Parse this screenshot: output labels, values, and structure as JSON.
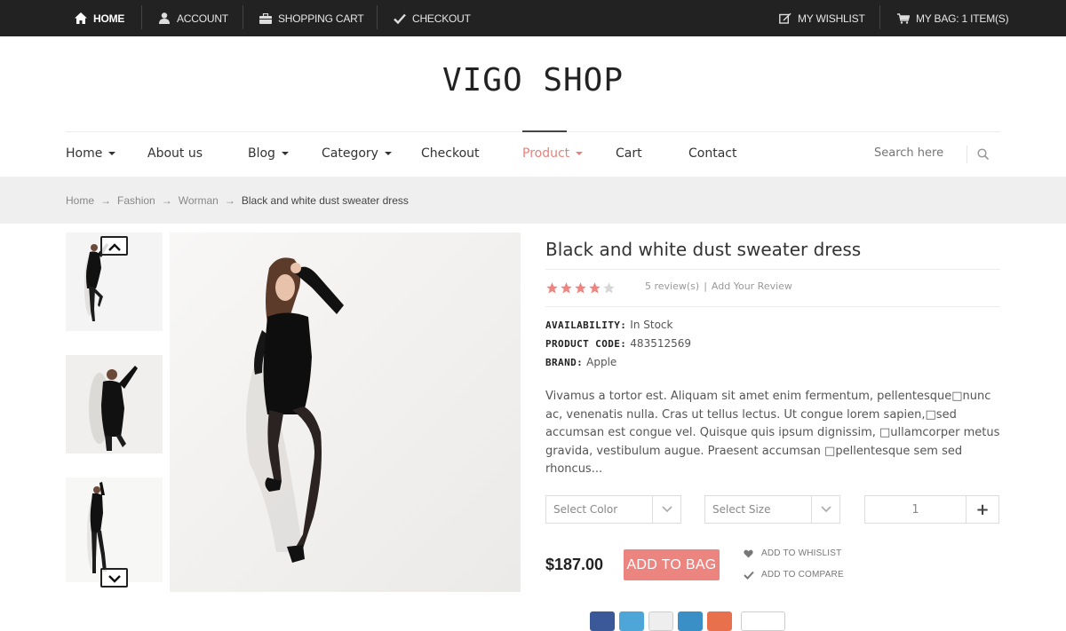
{
  "topbar": {
    "home": "HOME",
    "account": "ACCOUNT",
    "shopping_cart": "SHOPPING CART",
    "checkout": "CHECKOUT",
    "wishlist": "MY WISHLIST",
    "bag": "MY BAG: 1 ITEM(S)"
  },
  "logo": "VIGO SHOP",
  "nav": {
    "items": [
      {
        "label": "Home",
        "caret": true
      },
      {
        "label": "About us",
        "caret": false
      },
      {
        "label": "Blog",
        "caret": true
      },
      {
        "label": "Category",
        "caret": true
      },
      {
        "label": "Checkout",
        "caret": false
      },
      {
        "label": "Product",
        "caret": true
      },
      {
        "label": "Cart",
        "caret": false
      },
      {
        "label": "Contact",
        "caret": false
      }
    ],
    "search_placeholder": "Search here"
  },
  "breadcrumb": {
    "items": [
      "Home",
      "Fashion",
      "Worman"
    ],
    "current": "Black and white dust sweater dress"
  },
  "product": {
    "title": "Black and white dust sweater dress",
    "rating": 4,
    "rating_max": 5,
    "reviews": "5 review(s)",
    "add_review": "Add Your Review",
    "availability_label": "AVAILABILITY:",
    "availability": "In Stock",
    "code_label": "PRODUCT CODE:",
    "code": "483512569",
    "brand_label": "BRAND:",
    "brand": "Apple",
    "description": "Vivamus a tortor est. Aliquam sit amet enim fermentum, pellentesque□nunc ac, venenatis nulla. Cras ut tellus lectus. Ut congue lorem sapien,□sed accumsan est congue vel. Quisque quis ipsum dignissim, □ullamcorper metus gravida, vestibulum augue. Praesent accumsan □pellentesque sem sed rhoncus...",
    "select_color": "Select Color",
    "select_size": "Select Size",
    "quantity": "1",
    "price": "$187.00",
    "add_to_bag": "ADD TO BAG",
    "add_to_wishlist": "ADD TO WHISLIST",
    "add_to_compare": "ADD TO COMPARE"
  },
  "colors": {
    "topbar_bg": "#222222",
    "accent": "#ec8580",
    "star_on": "#ec8580",
    "star_off": "#d6d6d6"
  }
}
